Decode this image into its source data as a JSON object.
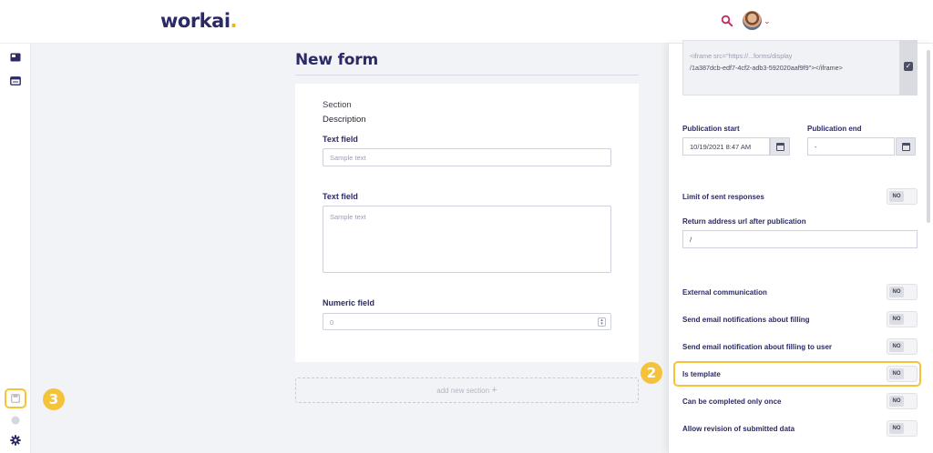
{
  "header": {
    "logo_text": "workai",
    "logo_dot": ".",
    "search_icon": "search-icon",
    "avatar": "user-avatar",
    "chevron": "⌄"
  },
  "rail": {
    "icons": [
      "news-icon",
      "calendar-card-icon",
      "save-icon",
      "circle-icon",
      "gear-icon"
    ]
  },
  "form": {
    "title": "New form",
    "section_label": "Section",
    "description_label": "Description",
    "fields": [
      {
        "label": "Text field",
        "placeholder": "Sample text"
      },
      {
        "label": "Text field",
        "placeholder": "Sample text"
      },
      {
        "label": "Numeric field",
        "placeholder": "0"
      }
    ],
    "add_section_label": "add new section",
    "add_section_plus": "+"
  },
  "panel": {
    "embed_code_line1": "<iframe src=\"https://...forms/display",
    "embed_code_line2": "/1a387dcb-edf7-4cf2-adb3-592020aaf9f9\"></iframe>",
    "publication_start_label": "Publication start",
    "publication_start_value": "10/19/2021 8:47 AM",
    "publication_end_label": "Publication end",
    "publication_end_value": "-",
    "limit_label": "Limit of sent responses",
    "return_url_label": "Return address url after publication",
    "return_url_value": "/",
    "toggles": [
      {
        "label": "External communication",
        "value": "NO"
      },
      {
        "label": "Send email notifications about filling",
        "value": "NO"
      },
      {
        "label": "Send email notification about filling to user",
        "value": "NO"
      },
      {
        "label": "Is template",
        "value": "NO"
      },
      {
        "label": "Can be completed only once",
        "value": "NO"
      },
      {
        "label": "Allow revision of submitted data",
        "value": "NO"
      }
    ],
    "limit_toggle_value": "NO"
  },
  "annotations": {
    "step2": "2",
    "step3": "3",
    "accent_color": "#f5c33b"
  }
}
